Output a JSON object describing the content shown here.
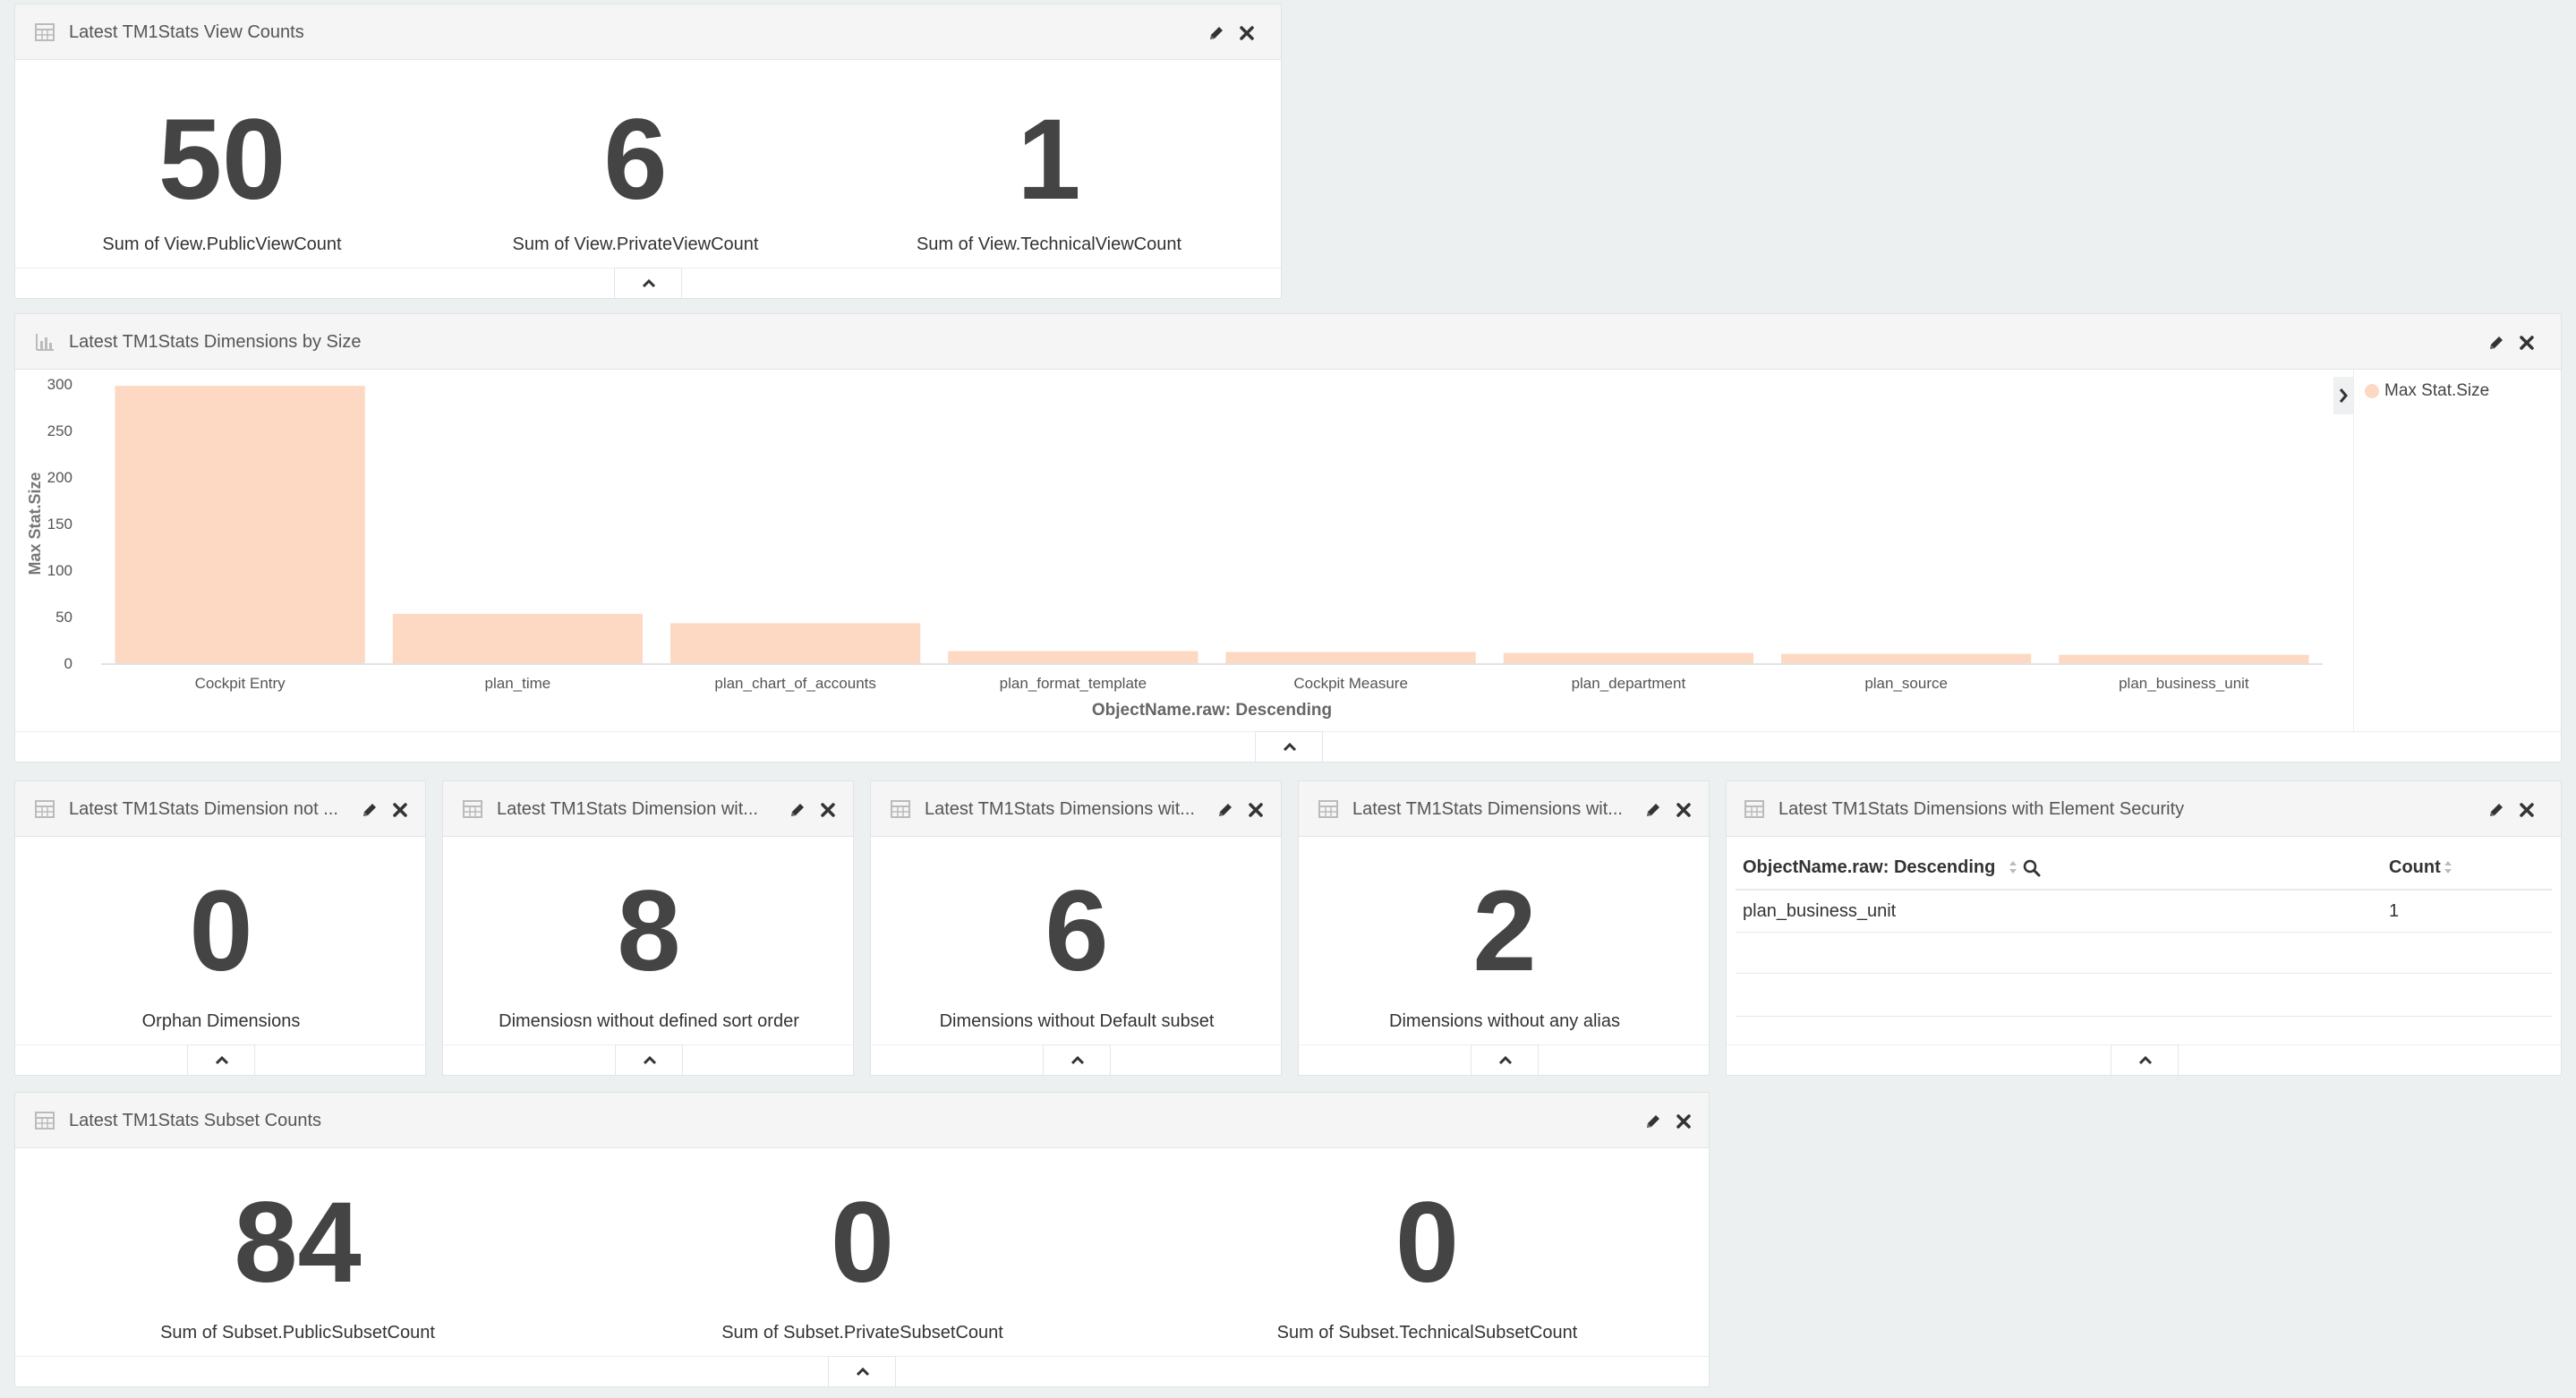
{
  "colors": {
    "bar": "#fdd8c2",
    "legend_dot": "#fdd8c2",
    "icon": "#bbbbbb",
    "action_icon": "#333333"
  },
  "panels": {
    "view_counts": {
      "title": "Latest TM1Stats View Counts",
      "metrics": [
        {
          "value": "50",
          "label": "Sum of View.PublicViewCount"
        },
        {
          "value": "6",
          "label": "Sum of View.PrivateViewCount"
        },
        {
          "value": "1",
          "label": "Sum of View.TechnicalViewCount"
        }
      ]
    },
    "dims_by_size": {
      "title": "Latest TM1Stats Dimensions by Size",
      "legend": {
        "label": "Max Stat.Size"
      }
    },
    "orphan": {
      "title": "Latest TM1Stats Dimension not ...",
      "value": "0",
      "label": "Orphan Dimensions"
    },
    "sort_order": {
      "title": "Latest TM1Stats Dimension wit...",
      "value": "8",
      "label": "Dimensiosn without defined sort order"
    },
    "default_subset": {
      "title": "Latest TM1Stats Dimensions wit...",
      "value": "6",
      "label": "Dimensions without Default subset"
    },
    "alias": {
      "title": "Latest TM1Stats Dimensions wit...",
      "value": "2",
      "label": "Dimensions without any alias"
    },
    "element_security": {
      "title": "Latest TM1Stats Dimensions with Element Security",
      "columns": [
        "ObjectName.raw: Descending",
        "Count"
      ],
      "rows": [
        [
          "plan_business_unit",
          "1"
        ]
      ]
    },
    "subset_counts": {
      "title": "Latest TM1Stats Subset Counts",
      "metrics": [
        {
          "value": "84",
          "label": "Sum of Subset.PublicSubsetCount"
        },
        {
          "value": "0",
          "label": "Sum of Subset.PrivateSubsetCount"
        },
        {
          "value": "0",
          "label": "Sum of Subset.TechnicalSubsetCount"
        }
      ]
    }
  },
  "chart_data": {
    "type": "bar",
    "title": "",
    "xlabel": "ObjectName.raw: Descending",
    "ylabel": "Max Stat.Size",
    "categories": [
      "Cockpit Entry",
      "plan_time",
      "plan_chart_of_accounts",
      "plan_format_template",
      "Cockpit Measure",
      "plan_department",
      "plan_source",
      "plan_business_unit"
    ],
    "series": [
      {
        "name": "Max Stat.Size",
        "values": [
          298,
          53,
          43,
          13,
          12,
          11,
          10,
          9
        ]
      }
    ],
    "yticks": [
      0,
      50,
      100,
      150,
      200,
      250,
      300
    ],
    "ylim": [
      0,
      300
    ],
    "legend_position": "right",
    "grid": false
  }
}
